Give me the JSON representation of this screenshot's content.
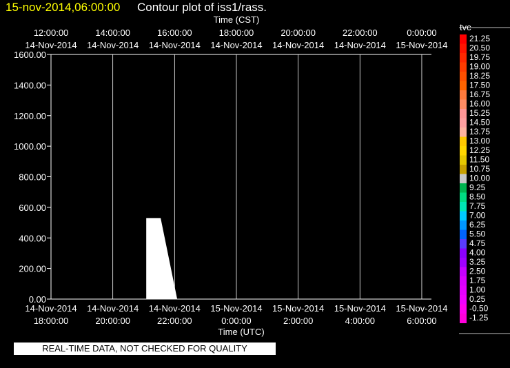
{
  "header": {
    "timestamp": "15-nov-2014,06:00:00",
    "title": "Contour plot of iss1/rass."
  },
  "footer": {
    "qc_notice": "REAL-TIME DATA, NOT CHECKED FOR QUALITY"
  },
  "chart_data": {
    "type": "heatmap",
    "title": "Contour plot of iss1/rass.",
    "top_xlabel": "Time (CST)",
    "xlabel": "Time (UTC)",
    "ylabel": "",
    "ylim": [
      0,
      1600
    ],
    "xlim_hours_utc": [
      "2014-11-14 18:00",
      "2014-11-15 06:12"
    ],
    "grid": "vertical lines at each 2-hour x tick",
    "y_ticks": [
      "0.00",
      "200.00",
      "400.00",
      "600.00",
      "800.00",
      "1000.00",
      "1200.00",
      "1400.00",
      "1600.00"
    ],
    "x_ticks_bottom": [
      {
        "date": "14-Nov-2014",
        "time": "18:00:00"
      },
      {
        "date": "14-Nov-2014",
        "time": "20:00:00"
      },
      {
        "date": "14-Nov-2014",
        "time": "22:00:00"
      },
      {
        "date": "15-Nov-2014",
        "time": "0:00:00"
      },
      {
        "date": "15-Nov-2014",
        "time": "2:00:00"
      },
      {
        "date": "15-Nov-2014",
        "time": "4:00:00"
      },
      {
        "date": "15-Nov-2014",
        "time": "6:00:00"
      }
    ],
    "x_ticks_top": [
      {
        "time": "12:00:00",
        "date": "14-Nov-2014"
      },
      {
        "time": "14:00:00",
        "date": "14-Nov-2014"
      },
      {
        "time": "16:00:00",
        "date": "14-Nov-2014"
      },
      {
        "time": "18:00:00",
        "date": "14-Nov-2014"
      },
      {
        "time": "20:00:00",
        "date": "14-Nov-2014"
      },
      {
        "time": "22:00:00",
        "date": "14-Nov-2014"
      },
      {
        "time": "0:00:00",
        "date": "15-Nov-2014"
      }
    ],
    "data_region": {
      "description": "white filled region (value above colour scale / missing)",
      "color": "#ffffff",
      "polygon_utc": [
        {
          "t": "2014-11-14 21:05",
          "y": 0
        },
        {
          "t": "2014-11-14 21:05",
          "y": 530
        },
        {
          "t": "2014-11-14 21:33",
          "y": 530
        },
        {
          "t": "2014-11-14 22:05",
          "y": 0
        }
      ]
    },
    "colorbar": {
      "label": "tvc",
      "levels": [
        "21.25",
        "20.50",
        "19.75",
        "19.00",
        "18.25",
        "17.50",
        "16.75",
        "16.00",
        "15.25",
        "14.50",
        "13.75",
        "13.00",
        "12.25",
        "11.50",
        "10.75",
        "10.00",
        "9.25",
        "8.50",
        "7.75",
        "7.00",
        "6.25",
        "5.50",
        "4.75",
        "4.00",
        "3.25",
        "2.50",
        "1.75",
        "1.00",
        "0.25",
        "-0.50",
        "-1.25"
      ],
      "colors": [
        "#ff0000",
        "#ff1400",
        "#ff2800",
        "#ff3c00",
        "#ff5000",
        "#ff6400",
        "#ff7a3c",
        "#ff8c64",
        "#ff9696",
        "#ffa0a0",
        "#ffb4a0",
        "#ffc800",
        "#ffd700",
        "#e6c800",
        "#c8a000",
        "#c8c8c8",
        "#00b450",
        "#00dc82",
        "#00e6b4",
        "#00c8ff",
        "#0096ff",
        "#0064ff",
        "#5a3cff",
        "#8c00ff",
        "#a000ff",
        "#c800ff",
        "#dc00ff",
        "#e600ff",
        "#f000ff",
        "#ff00f0",
        "#ff00dc"
      ]
    }
  }
}
